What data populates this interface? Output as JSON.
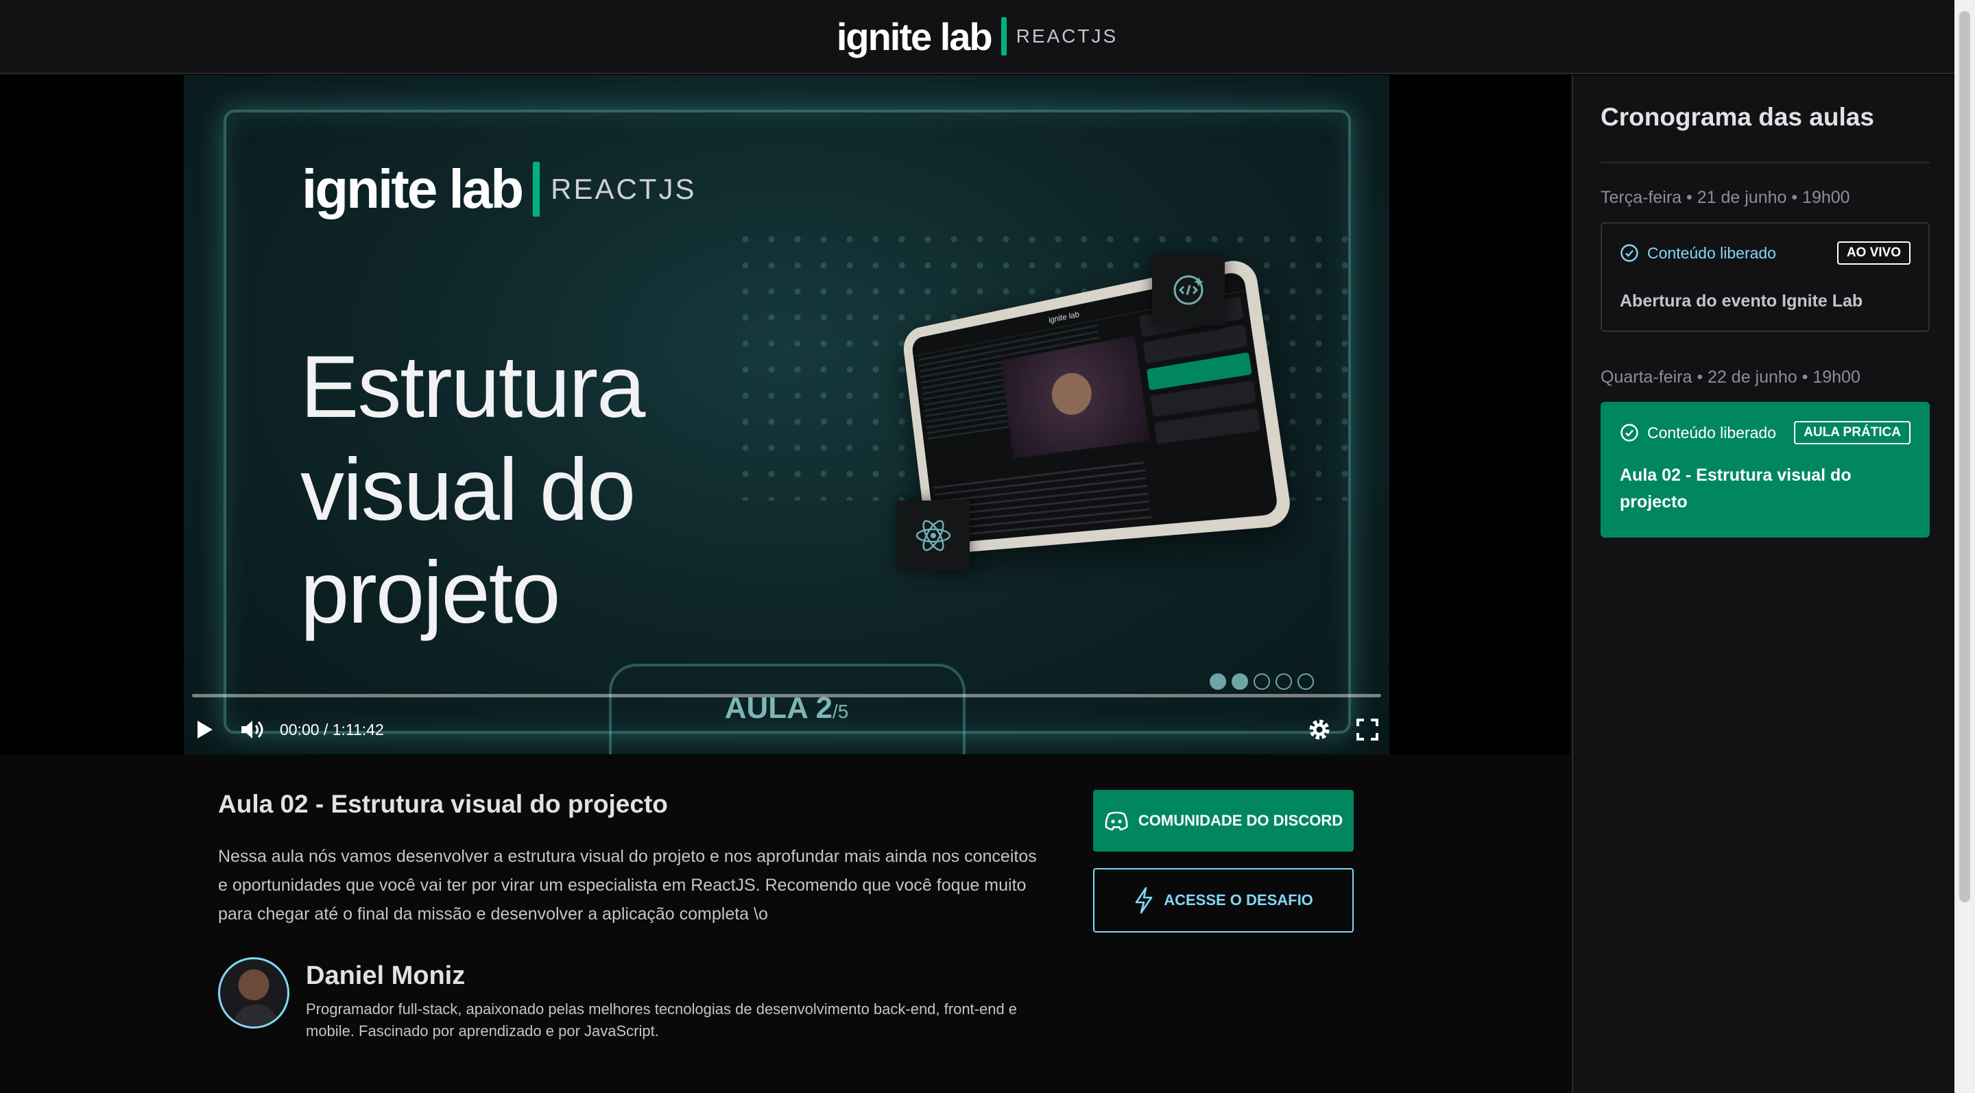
{
  "header": {
    "logo_main": "ignite lab",
    "logo_sub": "REACTJS"
  },
  "video": {
    "slide_logo_main": "ignite lab",
    "slide_logo_sub": "REACTJS",
    "slide_title": "Estrutura visual do projeto",
    "slide_lesson": "AULA 2",
    "slide_lesson_total": "/5",
    "tablet_title": "ignite lab",
    "time": "00:00 / 1:11:42",
    "progress": 0.0
  },
  "lesson": {
    "title": "Aula 02 - Estrutura visual do projecto",
    "description": "Nessa aula nós vamos desenvolver a estrutura visual do projeto e nos aprofundar mais ainda nos conceitos e oportunidades que você vai ter por virar um especialista em ReactJS. Recomendo que você foque muito para chegar até o final da missão e desenvolver a aplicação completa \\o",
    "discord_button": "COMUNIDADE DO DISCORD",
    "challenge_button": "ACESSE O DESAFIO"
  },
  "author": {
    "name": "Daniel Moniz",
    "bio": "Programador full-stack, apaixonado pelas melhores tecnologias de desenvolvimento back-end, front-end e mobile. Fascinado por aprendizado e por JavaScript."
  },
  "sidebar": {
    "title": "Cronograma das aulas",
    "lessons": [
      {
        "date": "Terça-feira • 21 de junho • 19h00",
        "status": "Conteúdo liberado",
        "tag": "AO VIVO",
        "title": "Abertura do evento Ignite Lab",
        "active": false
      },
      {
        "date": "Quarta-feira • 22 de junho • 19h00",
        "status": "Conteúdo liberado",
        "tag": "AULA PRÁTICA",
        "title": "Aula 02 - Estrutura visual do projecto",
        "active": true
      }
    ]
  },
  "colors": {
    "green": "#00875f",
    "accent_green": "#00b37e",
    "blue": "#81d8f7",
    "bg": "#09090a",
    "panel": "#121214"
  },
  "icons": [
    "play-icon",
    "volume-icon",
    "settings-icon",
    "fullscreen-icon",
    "discord-icon",
    "lightning-icon",
    "check-circle-icon",
    "react-icon",
    "code-icon"
  ]
}
